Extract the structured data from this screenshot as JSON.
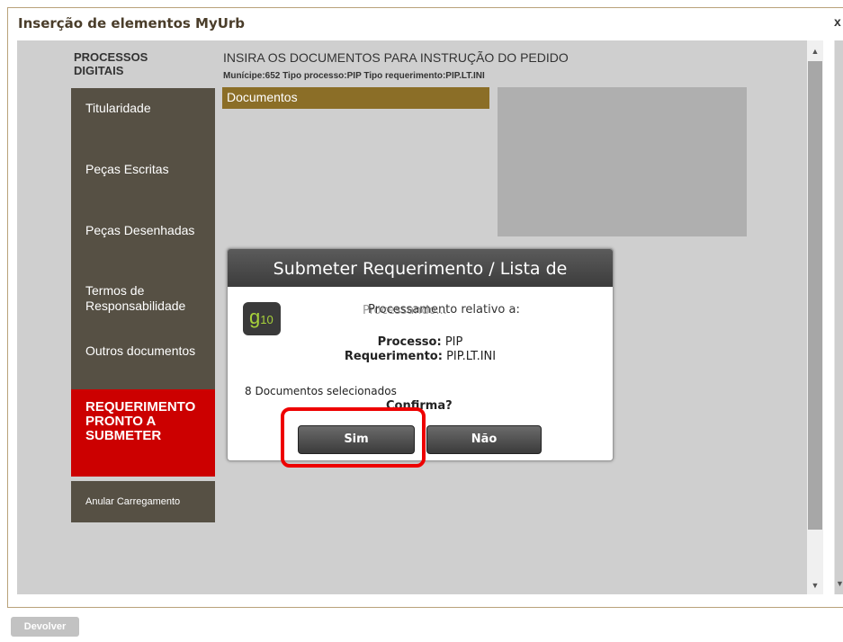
{
  "window": {
    "title": "Inserção de elementos MyUrb",
    "close_label": "x"
  },
  "header": {
    "section_title": "PROCESSOS DIGITAIS",
    "main_heading": "INSIRA OS DOCUMENTOS PARA INSTRUÇÃO DO PEDIDO",
    "subinfo": "Munícipe:652  Tipo processo:PIP  Tipo requerimento:PIP.LT.INI"
  },
  "sidebar": {
    "items": [
      {
        "label": "Titularidade"
      },
      {
        "label": "Peças Escritas"
      },
      {
        "label": "Peças Desenhadas"
      },
      {
        "label": "Termos de Responsabilidade"
      },
      {
        "label": "Outros documentos"
      }
    ],
    "active_item": "REQUERIMENTO PRONTO A SUBMETER",
    "anular_label": "Anular Carregamento"
  },
  "documents_tab": {
    "label": "Documentos"
  },
  "dialog": {
    "title": "Submeter Requerimento / Lista de",
    "icon_text": "g",
    "icon_sub": "10",
    "ghost_text_1": "Processamento relativo a:",
    "ghost_text_2": "Processando...",
    "processo_label": "Processo:",
    "processo_value": "PIP",
    "requerimento_label": "Requerimento:",
    "requerimento_value": "PIP.LT.INI",
    "docs_selected": "8 Documentos selecionados",
    "confirm_question": "Confirma?",
    "yes_label": "Sim",
    "no_label": "Não"
  },
  "footer": {
    "devolver_label": "Devolver"
  },
  "colors": {
    "sidebar_bg": "#565044",
    "active_bg": "#cc0000",
    "tab_bg": "#8b6e27",
    "highlight": "#ee0000"
  }
}
